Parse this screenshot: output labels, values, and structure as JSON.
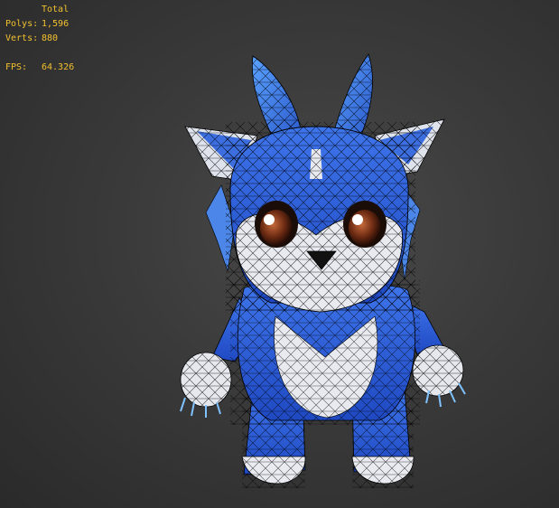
{
  "viewport": {
    "stats": {
      "header": "Total",
      "polys_label": "Polys:",
      "polys_value": "1,596",
      "verts_label": "Verts:",
      "verts_value": "880",
      "fps_label": "FPS:",
      "fps_value": "64.326"
    },
    "colors": {
      "stats_text": "#f2c12e",
      "background": "#3a3a3a",
      "body_blue": "#2f5fd6",
      "fur_white": "#e6e8ee",
      "wire": "#000000"
    }
  }
}
